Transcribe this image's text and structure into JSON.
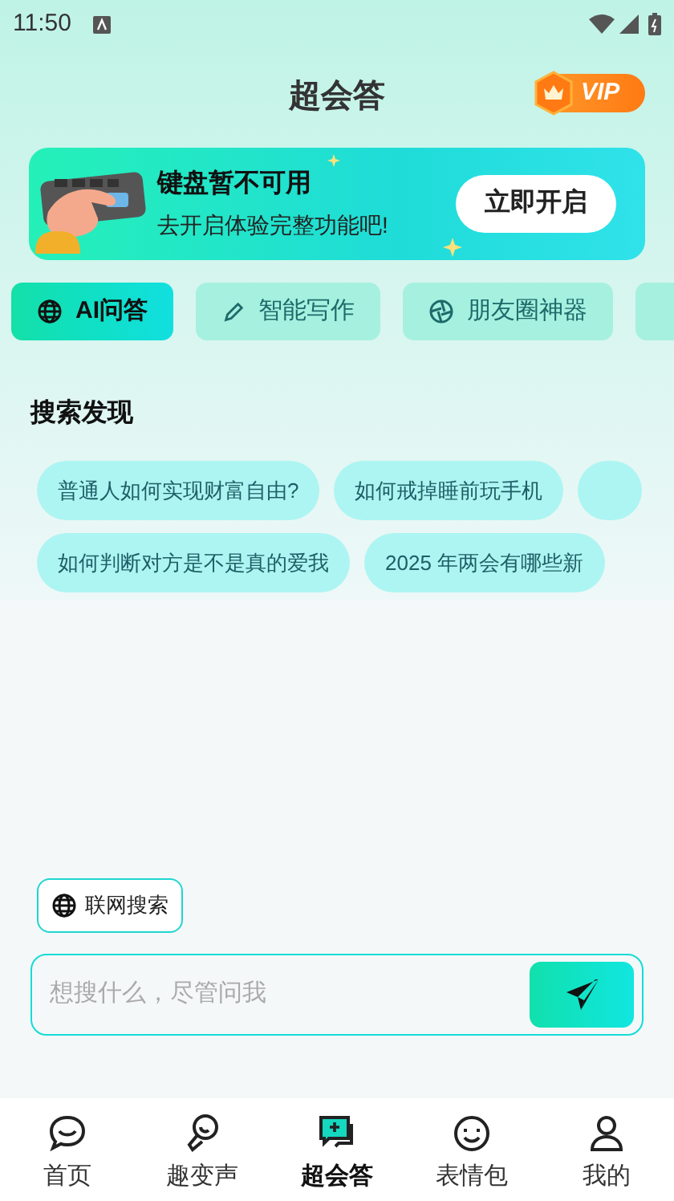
{
  "status_bar": {
    "time": "11:50"
  },
  "header": {
    "title": "超会答",
    "vip_badge": "VIP"
  },
  "banner": {
    "title": "键盘暂不可用",
    "subtitle": "去开启体验完整功能吧!",
    "button": "立即开启"
  },
  "tabs": [
    {
      "label": "AI问答",
      "selected": true
    },
    {
      "label": "智能写作",
      "selected": false
    },
    {
      "label": "朋友圈神器",
      "selected": false
    },
    {
      "selected": false
    }
  ],
  "discover": {
    "heading": "搜索发现",
    "rows": [
      [
        {
          "text": "普通人如何实现财富自由?"
        },
        {
          "text": "如何戒掉睡前玩手机"
        },
        {}
      ],
      [
        {
          "text": "如何判断对方是不是真的爱我"
        },
        {
          "text": "2025 年两会有哪些新"
        }
      ]
    ]
  },
  "web_search": {
    "label": "联网搜索",
    "on": false
  },
  "input": {
    "placeholder": "想搜什么，尽管问我"
  },
  "nav": [
    {
      "label": "首页",
      "selected": false
    },
    {
      "label": "趣变声",
      "selected": false
    },
    {
      "label": "超会答",
      "selected": true
    },
    {
      "label": "表情包",
      "selected": false
    },
    {
      "label": "我的",
      "selected": false
    }
  ]
}
